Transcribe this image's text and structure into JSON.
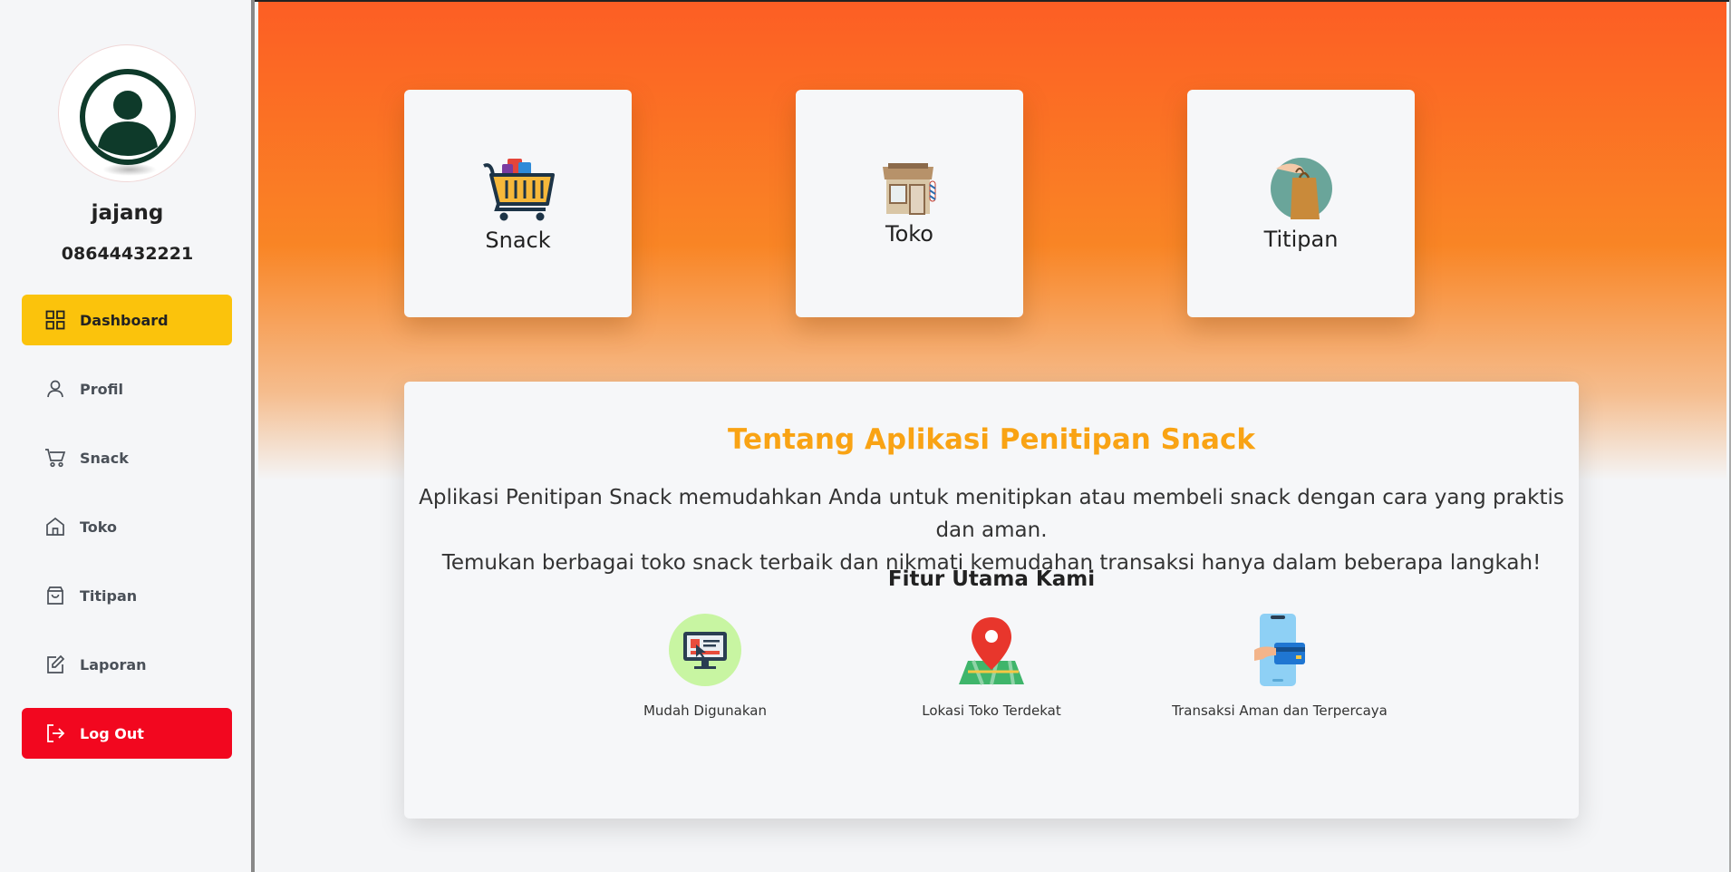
{
  "user": {
    "name": "jajang",
    "phone": "08644432221"
  },
  "sidebar": {
    "items": [
      {
        "label": "Dashboard",
        "icon": "grid-icon"
      },
      {
        "label": "Profil",
        "icon": "user-icon"
      },
      {
        "label": "Snack",
        "icon": "cart-icon"
      },
      {
        "label": "Toko",
        "icon": "home-icon"
      },
      {
        "label": "Titipan",
        "icon": "bag-icon"
      },
      {
        "label": "Laporan",
        "icon": "edit-icon"
      }
    ],
    "logout_label": "Log Out",
    "active_color": "#fbc30c",
    "logout_color": "#f2071f"
  },
  "cards": [
    {
      "label": "Snack",
      "icon": "shopping-basket-icon"
    },
    {
      "label": "Toko",
      "icon": "store-icon"
    },
    {
      "label": "Titipan",
      "icon": "hand-holding-bag-icon"
    }
  ],
  "about": {
    "title": "Tentang Aplikasi Penitipan Snack",
    "desc_line1": "Aplikasi Penitipan Snack memudahkan Anda untuk menitipkan atau membeli snack dengan cara yang praktis dan aman.",
    "desc_line2": "Temukan berbagai toko snack terbaik dan nikmati kemudahan transaksi hanya dalam beberapa langkah!",
    "features_title": "Fitur Utama Kami",
    "features": [
      {
        "label": "Mudah Digunakan",
        "icon": "computer-screen-icon"
      },
      {
        "label": "Lokasi Toko Terdekat",
        "icon": "map-pin-icon"
      },
      {
        "label": "Transaksi Aman dan Terpercaya",
        "icon": "phone-card-payment-icon"
      }
    ]
  },
  "colors": {
    "accent": "#f9a314",
    "header_gradient_top": "#fd5e24"
  }
}
